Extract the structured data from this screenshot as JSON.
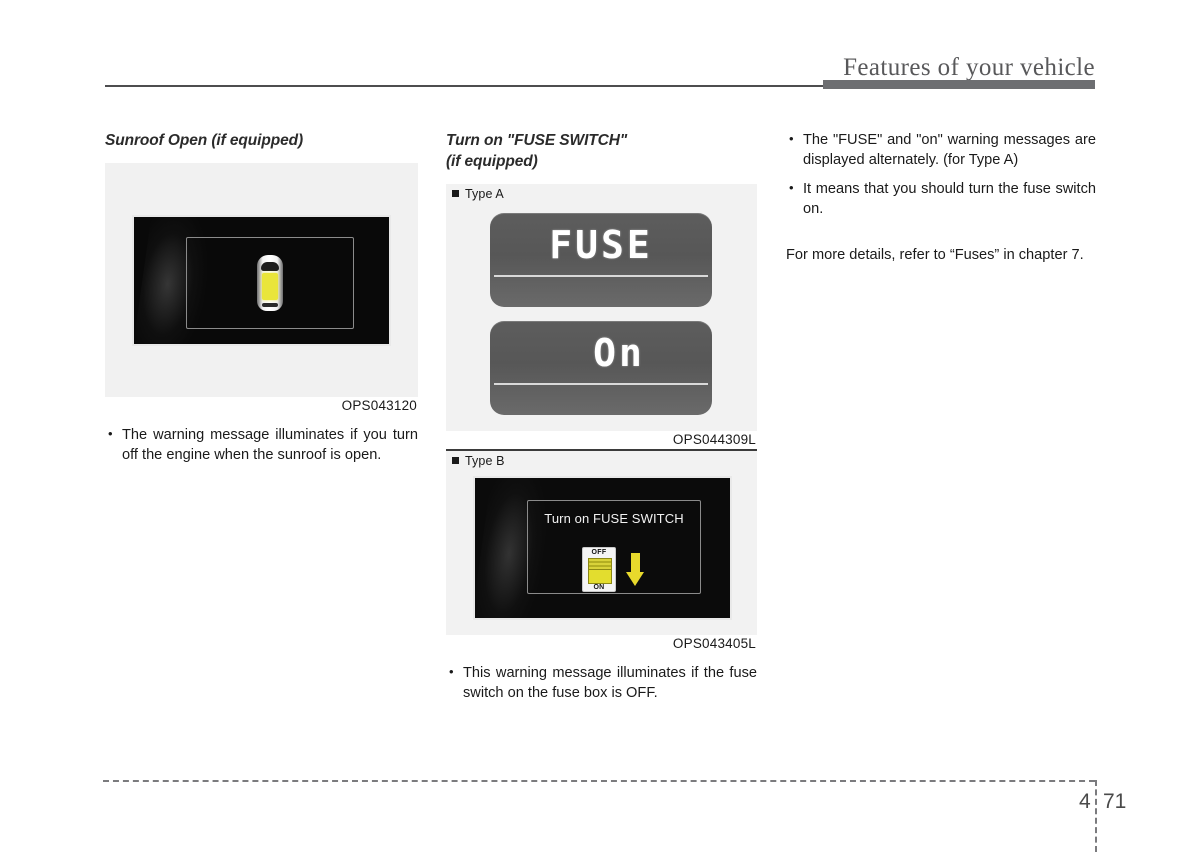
{
  "header": {
    "title": "Features of your vehicle"
  },
  "columns": {
    "left": {
      "heading": "Sunroof Open (if equipped)",
      "figure": {
        "caption": "OPS043120",
        "display_icon": "car-top-view-sunroof-open-icon"
      },
      "bullets": [
        "The warning message illuminates if you turn off the engine when the sunroof is open."
      ]
    },
    "middle": {
      "heading_line1": "Turn on \"FUSE SWITCH\"",
      "heading_line2": "(if equipped)",
      "type_a": {
        "label": "Type A",
        "lcd_top_text": "FUSE",
        "lcd_bottom_text": "On",
        "caption": "OPS044309L"
      },
      "type_b": {
        "label": "Type B",
        "display_message": "Turn on FUSE SWITCH",
        "switch_off_label": "OFF",
        "switch_on_label": "ON",
        "arrow_icon": "arrow-down-icon",
        "caption": "OPS043405L"
      },
      "bullets": [
        "This warning message illuminates if the fuse switch on the fuse box is OFF."
      ]
    },
    "right": {
      "bullets": [
        "The \"FUSE\" and \"on\" warning messages are displayed alternately. (for Type A)",
        "It means that you should turn the fuse switch on."
      ],
      "note": "For more details, refer to “Fuses” in chapter 7."
    }
  },
  "footer": {
    "chapter": "4",
    "page": "71"
  },
  "colors": {
    "header_rule": "#4d4d4f",
    "header_bar": "#6d6e71",
    "sunroof_highlight": "#e9e53a",
    "switch_yellow": "#e3dd2e",
    "arrow_yellow": "#e8d92c"
  }
}
